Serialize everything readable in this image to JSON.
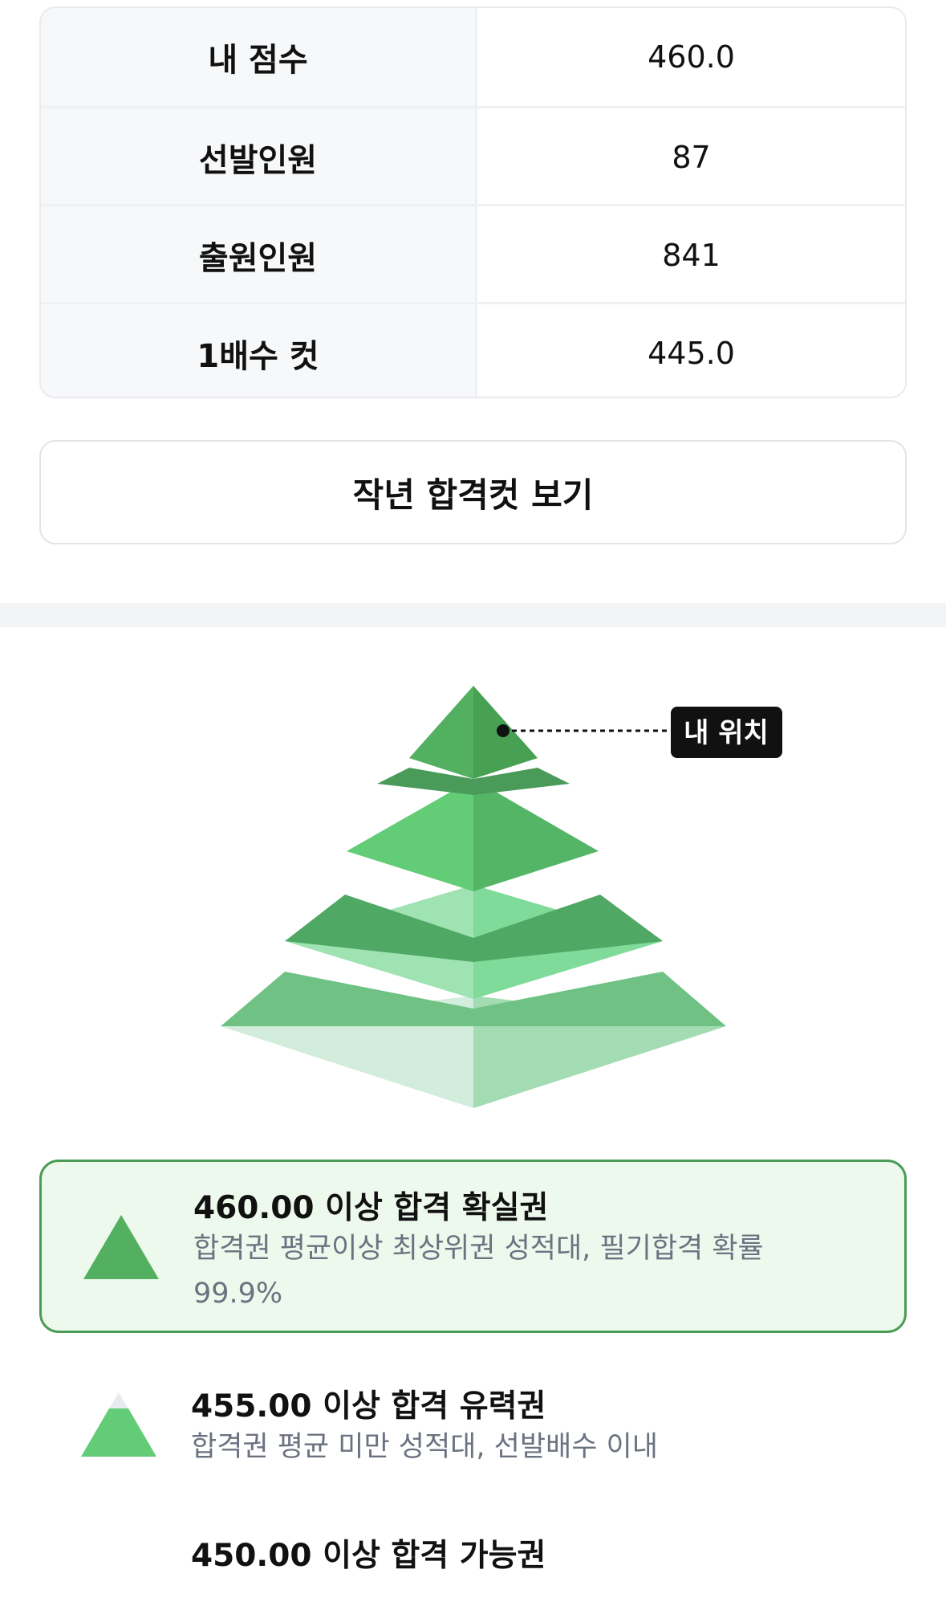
{
  "stats": {
    "rows": [
      {
        "label": "내 점수",
        "value": "460.0"
      },
      {
        "label": "선발인원",
        "value": "87"
      },
      {
        "label": "출원인원",
        "value": "841"
      },
      {
        "label": "1배수 컷",
        "value": "445.0"
      }
    ]
  },
  "prev_cut_button": "작년 합격컷 보기",
  "pyramid": {
    "my_position_label": "내 위치"
  },
  "tiers": [
    {
      "title": "460.00 이상 합격 확실권",
      "desc": "합격권 평균이상 최상위권 성적대, 필기합격 확률 99.9%"
    },
    {
      "title": "455.00 이상 합격 유력권",
      "desc": "합격권 평균 미만 성적대, 선발배수 이내"
    },
    {
      "title": "450.00 이상 합격 가능권",
      "desc": ""
    }
  ],
  "colors": {
    "accent_green": "#4a9c54",
    "active_bg": "#eef9ee",
    "tier1_green": "#53b060",
    "tier2_green": "#62cc76",
    "tier3_green": "#9fe3b2",
    "tier4_green": "#d2eddb"
  }
}
